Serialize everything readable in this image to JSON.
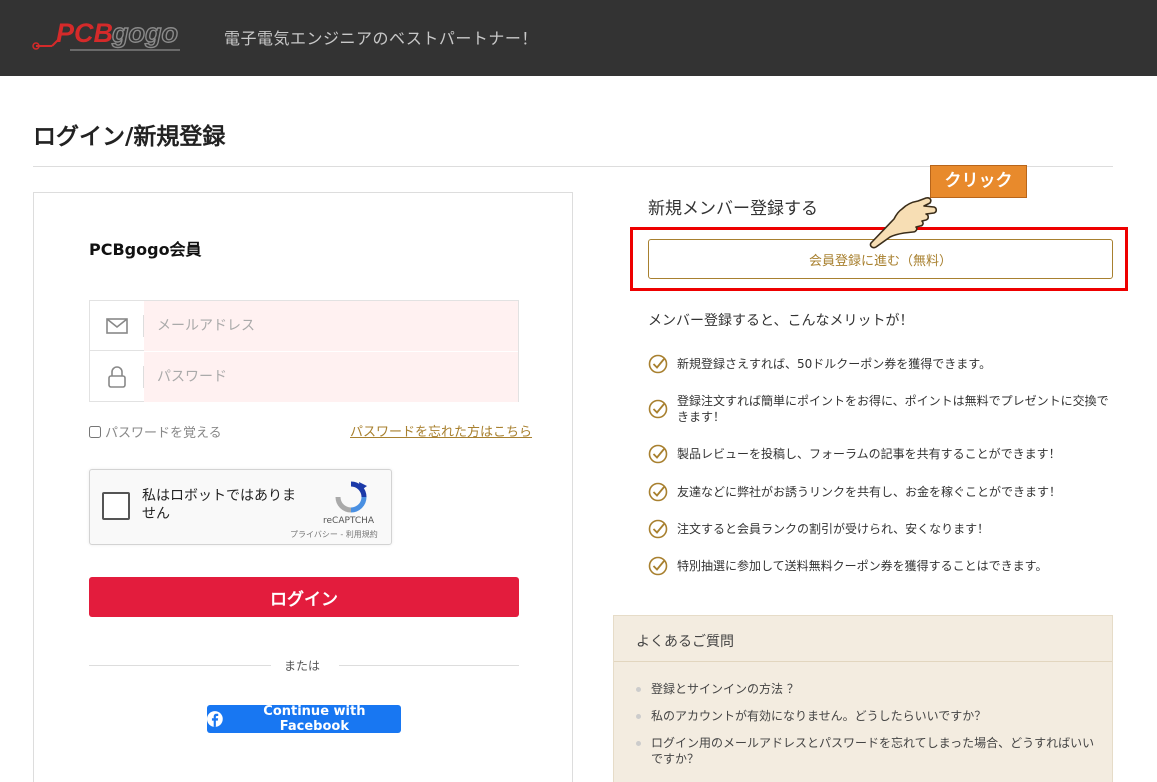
{
  "header": {
    "logo_text": "PCBgogo",
    "tagline": "電子電気エンジニアのベストパートナー！"
  },
  "page": {
    "title": "ログイン/新規登録"
  },
  "login": {
    "member_heading": "PCBgogo会員",
    "email_placeholder": "メールアドレス",
    "password_placeholder": "パスワード",
    "remember_label": "パスワードを覚える",
    "forgot_link": "パスワードを忘れた方はこちら",
    "recaptcha": {
      "label": "私はロボットではありません",
      "brand": "reCAPTCHA",
      "links": "プライバシー - 利用規約"
    },
    "login_button": "ログイン",
    "or_text": "または",
    "facebook_button": "Continue with Facebook"
  },
  "register": {
    "heading": "新規メンバー登録する",
    "callout": "クリック",
    "button": "会員登録に進む（無料）",
    "benefit_intro": "メンバー登録すると、こんなメリットが！",
    "benefits": [
      "新規登録さえすれば、50ドルクーポン券を獲得できます。",
      "登録注文すれば簡単にポイントをお得に、ポイントは無料でプレゼントに交換できます！",
      "製品レビューを投稿し、フォーラムの記事を共有することができます！",
      "友達などに弊社がお誘うリンクを共有し、お金を稼ぐことができます！",
      "注文すると会員ランクの割引が受けられ、安くなります！",
      "特別抽選に参加して送料無料クーポン券を獲得することはできます。"
    ]
  },
  "faq": {
    "title": "よくあるご質問",
    "items": [
      "登録とサインインの方法 ？",
      "私のアカウントが有効になりません。どうしたらいいですか？",
      "ログイン用のメールアドレスとパスワードを忘れてしまった場合、どうすればいいですか？"
    ]
  },
  "colors": {
    "header_bg": "#333333",
    "brand_red": "#e31c3d",
    "accent_gold": "#a8802f",
    "callout_orange": "#e88a2c",
    "highlight_frame": "#ee0000",
    "facebook_blue": "#1877f2",
    "faq_bg": "#f3ece0"
  },
  "icons": {
    "email": "envelope-icon",
    "password": "lock-icon",
    "benefit": "check-circle-icon",
    "facebook": "facebook-icon",
    "pointer": "pointing-hand-icon"
  }
}
